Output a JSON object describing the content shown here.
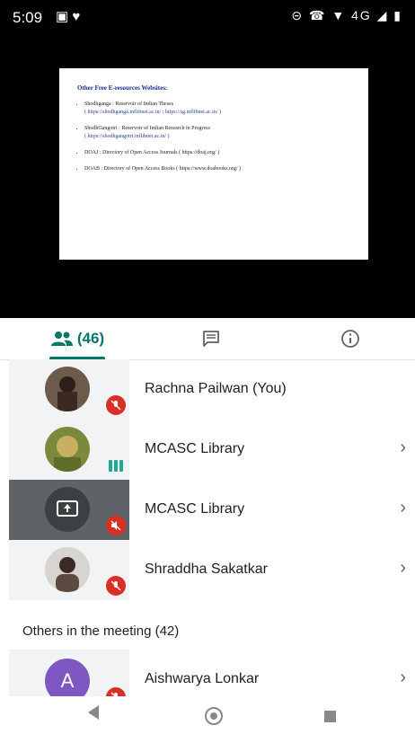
{
  "status_bar": {
    "time": "5:09",
    "left_icons": "▣ ♥",
    "right_icons": "⊝ ☎ ▼ 4G ◢ ▮"
  },
  "slide": {
    "title": "Other Free E-resources Websites:",
    "items": [
      {
        "main": "Shodhganga : Reservoir of Indian Theses",
        "sub": "( https://shodhganga.inflibnet.ac.in/ ; https://sg.inflibnet.ac.in/ )"
      },
      {
        "main": "ShodhGangotri : Reservoir of Indian Research in Progress",
        "sub": "( https://shodhgangotri.inflibnet.ac.in/ )"
      },
      {
        "main": "DOAJ : Directory of Open Access Journals ( https://doaj.org/ )",
        "sub": ""
      },
      {
        "main": "DOAB : Directory of Open Access Books ( https://www.doabooks.org/ )",
        "sub": ""
      }
    ]
  },
  "tabs": {
    "people_count": "(46)",
    "chat_icon": "chat-icon",
    "info_icon": "info-icon",
    "accent_color": "#00796b"
  },
  "participants": [
    {
      "name": "Rachna Pailwan (You)",
      "status": "muted",
      "avatar": "photo"
    },
    {
      "name": "MCASC Library",
      "status": "speaking",
      "avatar": "photo"
    },
    {
      "name": "MCASC Library",
      "status": "muted",
      "avatar": "presentation"
    },
    {
      "name": "Shraddha Sakatkar",
      "status": "muted",
      "avatar": "photo"
    }
  ],
  "others_section": {
    "title": "Others in the meeting (42)",
    "items": [
      {
        "initial": "A",
        "name": "Aishwarya Lonkar",
        "avatar_color": "#7e57c2"
      }
    ]
  },
  "chevron": "›",
  "mute_color": "#d93025"
}
